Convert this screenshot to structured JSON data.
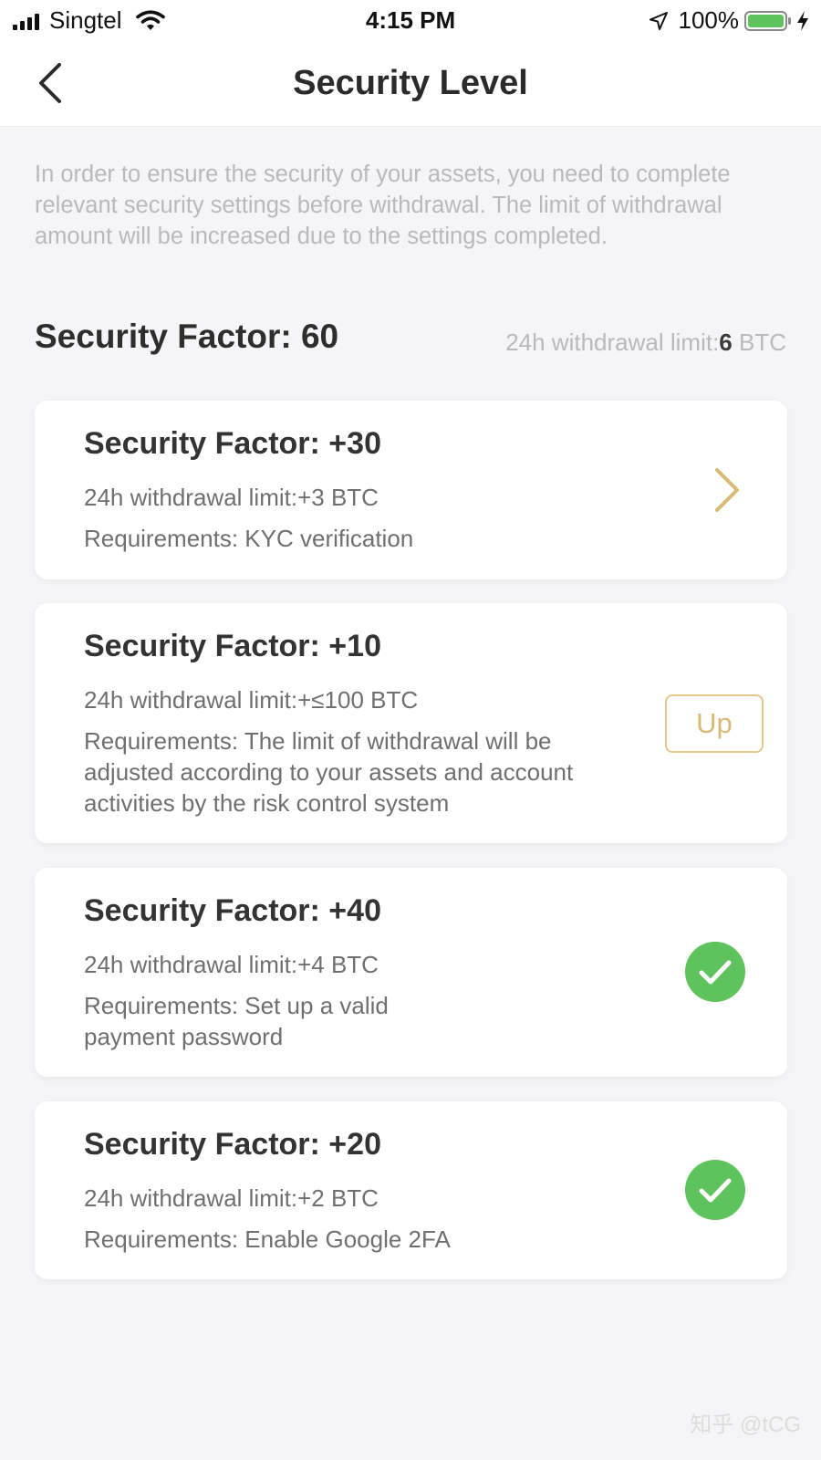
{
  "status_bar": {
    "carrier": "Singtel",
    "time": "4:15 PM",
    "battery": "100%",
    "icons": [
      "signal-icon",
      "wifi-icon",
      "location-arrow-icon",
      "battery-icon",
      "charging-bolt-icon"
    ]
  },
  "nav": {
    "title": "Security Level",
    "back_icon": "chevron-left-icon"
  },
  "intro": "In order to ensure the security of your assets, you need to complete relevant security settings before withdrawal. The limit of withdrawal amount will be increased due to the settings completed.",
  "summary": {
    "factor": "Security Factor: 60",
    "limit_prefix": "24h withdrawal limit:",
    "limit_value": "6",
    "limit_unit": " BTC"
  },
  "cards": [
    {
      "title": "Security Factor: +30",
      "limit": "24h withdrawal limit:+3 BTC",
      "requirements": "Requirements: KYC verification",
      "action": "chevron-right-icon"
    },
    {
      "title": "Security Factor: +10",
      "limit": "24h withdrawal limit:+≤100 BTC",
      "requirements": "Requirements: The limit of withdrawal will be adjusted according to your assets and account activities by the risk control system",
      "action_label": "Up"
    },
    {
      "title": "Security Factor: +40",
      "limit": "24h withdrawal limit:+4 BTC",
      "requirements": "Requirements: Set up a valid payment password",
      "action": "check-circle-icon"
    },
    {
      "title": "Security Factor: +20",
      "limit": "24h withdrawal limit:+2 BTC",
      "requirements": "Requirements: Enable Google 2FA",
      "action": "check-circle-icon"
    }
  ],
  "colors": {
    "accent_gold": "#d9b976",
    "success_green": "#5ec35c",
    "background": "#f5f5f7",
    "muted_text": "#b9b9bd"
  },
  "watermark": "知乎 @tCG"
}
